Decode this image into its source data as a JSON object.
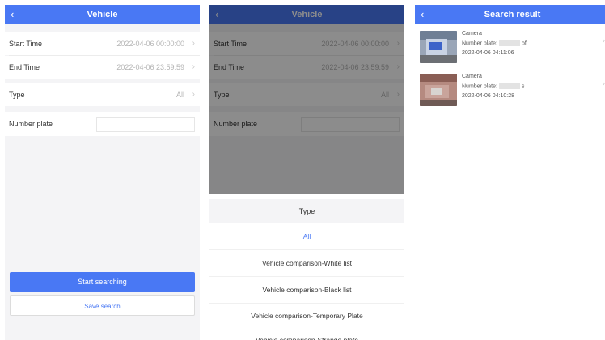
{
  "screen1": {
    "title": "Vehicle",
    "rows": {
      "start_time_label": "Start Time",
      "start_time_value": "2022-04-06 00:00:00",
      "end_time_label": "End Time",
      "end_time_value": "2022-04-06 23:59:59",
      "type_label": "Type",
      "type_value": "All",
      "plate_label": "Number plate",
      "plate_value": ""
    },
    "start_button": "Start searching",
    "save_button": "Save search"
  },
  "screen2": {
    "title": "Vehicle",
    "rows": {
      "start_time_label": "Start Time",
      "start_time_value": "2022-04-06 00:00:00",
      "end_time_label": "End Time",
      "end_time_value": "2022-04-06 23:59:59",
      "type_label": "Type",
      "type_value": "All",
      "plate_label": "Number plate"
    },
    "sheet": {
      "title": "Type",
      "options": [
        "All",
        "Vehicle comparison-White list",
        "Vehicle comparison-Black list",
        "Vehicle comparison-Temporary Plate",
        "Vehicle comparison-Strange plate"
      ],
      "selected_index": 0
    }
  },
  "screen3": {
    "title": "Search result",
    "results": [
      {
        "title": "Camera",
        "plate_label": "Number plate:",
        "plate_suffix": "of",
        "time": "2022-04-06 04:11:06"
      },
      {
        "title": "Camera",
        "plate_label": "Number plate:",
        "plate_suffix": "s",
        "time": "2022-04-06 04:10:28"
      }
    ]
  },
  "colors": {
    "accent": "#4978f4",
    "muted": "#b4b4b4",
    "background": "#f4f4f6"
  },
  "icons": {
    "back": "chevron-left-icon",
    "chevron": "chevron-right-icon"
  }
}
